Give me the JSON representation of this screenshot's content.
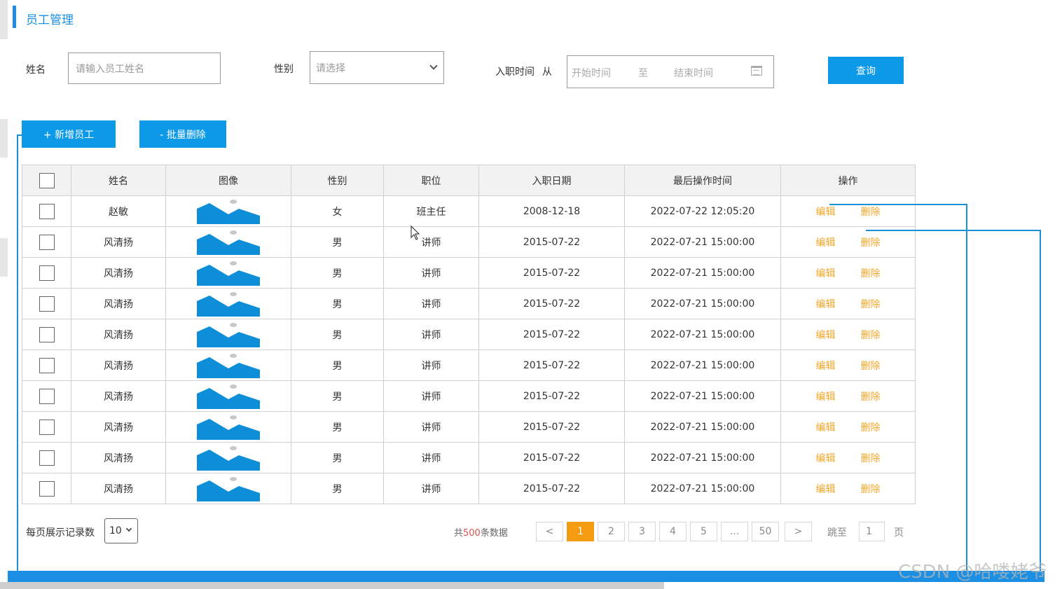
{
  "header": {
    "title": "员工管理"
  },
  "search": {
    "name_label": "姓名",
    "name_placeholder": "请输入员工姓名",
    "gender_label": "性别",
    "gender_value": "请选择",
    "date_label": "入职时间",
    "date_from_label": "从",
    "date_start_placeholder": "开始时间",
    "date_to_label": "至",
    "date_end_placeholder": "结束时间",
    "query_button": "查询"
  },
  "toolbar": {
    "add_button": "+ 新增员工",
    "batch_delete_button": "- 批量删除"
  },
  "table": {
    "columns": [
      "姓名",
      "图像",
      "性别",
      "职位",
      "入职日期",
      "最后操作时间",
      "操作"
    ],
    "edit_label": "编辑",
    "delete_label": "删除",
    "rows": [
      {
        "name": "赵敏",
        "gender": "女",
        "position": "班主任",
        "entry_date": "2008-12-18",
        "last_op": "2022-07-22 12:05:20"
      },
      {
        "name": "风清扬",
        "gender": "男",
        "position": "讲师",
        "entry_date": "2015-07-22",
        "last_op": "2022-07-21 15:00:00"
      },
      {
        "name": "风清扬",
        "gender": "男",
        "position": "讲师",
        "entry_date": "2015-07-22",
        "last_op": "2022-07-21 15:00:00"
      },
      {
        "name": "风清扬",
        "gender": "男",
        "position": "讲师",
        "entry_date": "2015-07-22",
        "last_op": "2022-07-21 15:00:00"
      },
      {
        "name": "风清扬",
        "gender": "男",
        "position": "讲师",
        "entry_date": "2015-07-22",
        "last_op": "2022-07-21 15:00:00"
      },
      {
        "name": "风清扬",
        "gender": "男",
        "position": "讲师",
        "entry_date": "2015-07-22",
        "last_op": "2022-07-21 15:00:00"
      },
      {
        "name": "风清扬",
        "gender": "男",
        "position": "讲师",
        "entry_date": "2015-07-22",
        "last_op": "2022-07-21 15:00:00"
      },
      {
        "name": "风清扬",
        "gender": "男",
        "position": "讲师",
        "entry_date": "2015-07-22",
        "last_op": "2022-07-21 15:00:00"
      },
      {
        "name": "风清扬",
        "gender": "男",
        "position": "讲师",
        "entry_date": "2015-07-22",
        "last_op": "2022-07-21 15:00:00"
      },
      {
        "name": "风清扬",
        "gender": "男",
        "position": "讲师",
        "entry_date": "2015-07-22",
        "last_op": "2022-07-21 15:00:00"
      }
    ]
  },
  "pagination": {
    "page_size_label": "每页展示记录数",
    "page_size_value": "10",
    "total_prefix": "共",
    "total_count": "500",
    "total_suffix": "条数据",
    "prev": "<",
    "pages": [
      "1",
      "2",
      "3",
      "4",
      "5",
      "...",
      "50"
    ],
    "next": ">",
    "jump_label": "跳至",
    "jump_value": "1",
    "page_suffix": "页"
  },
  "watermark": "CSDN @哈喽姥爷",
  "colors": {
    "accent": "#1a8fe3",
    "button": "#0b99e8",
    "action": "#f5a623",
    "active_page": "#f39c12"
  }
}
